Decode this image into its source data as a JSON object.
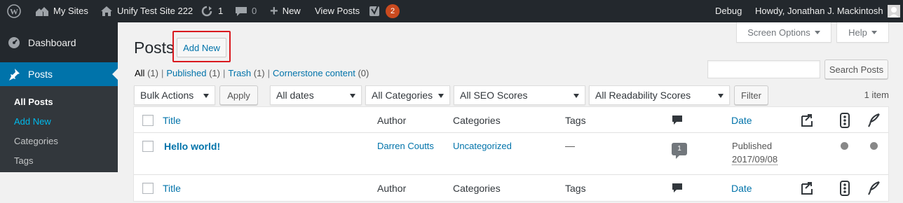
{
  "adminbar": {
    "my_sites": "My Sites",
    "site_name": "Unify Test Site 222",
    "updates_count": "1",
    "comments_count": "0",
    "new_label": "New",
    "view_posts": "View Posts",
    "yoast_badge": "2",
    "debug": "Debug",
    "howdy": "Howdy, Jonathan J. Mackintosh"
  },
  "sidebar": {
    "dashboard": "Dashboard",
    "posts": "Posts",
    "submenu": [
      "All Posts",
      "Add New",
      "Categories",
      "Tags"
    ]
  },
  "header": {
    "title": "Posts",
    "add_new": "Add New",
    "screen_options": "Screen Options",
    "help": "Help"
  },
  "views": [
    {
      "label": "All",
      "count": "(1)"
    },
    {
      "label": "Published",
      "count": "(1)"
    },
    {
      "label": "Trash",
      "count": "(1)"
    },
    {
      "label": "Cornerstone content",
      "count": "(0)"
    }
  ],
  "search": {
    "button": "Search Posts",
    "value": ""
  },
  "filters": {
    "bulk_actions": "Bulk Actions",
    "apply": "Apply",
    "dates": "All dates",
    "categories": "All Categories",
    "seo": "All SEO Scores",
    "readability": "All Readability Scores",
    "filter": "Filter",
    "items_count": "1 item"
  },
  "table": {
    "columns": {
      "title": "Title",
      "author": "Author",
      "categories": "Categories",
      "tags": "Tags",
      "date": "Date"
    },
    "rows": [
      {
        "title": "Hello world!",
        "author": "Darren Coutts",
        "categories": "Uncategorized",
        "tags": "—",
        "comments": "1",
        "status": "Published",
        "date": "2017/09/08"
      }
    ]
  },
  "colors": {
    "adminbar": "#23282d",
    "accent": "#0073aa",
    "highlight": "#d9191e",
    "badge": "#ca4a1f"
  }
}
